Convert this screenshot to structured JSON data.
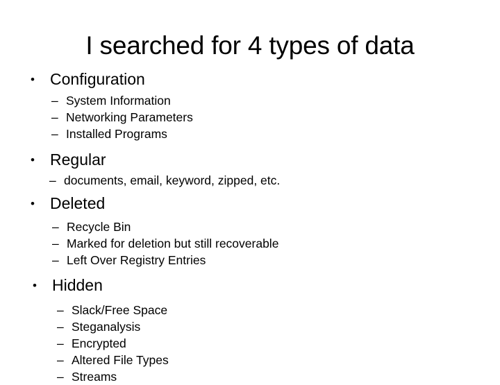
{
  "slide": {
    "title": "I searched for 4 types of data",
    "background_color": "#ffffff",
    "text_color": "#000000",
    "level1_bullet_glyph": "•",
    "level2_bullet_glyph": "–",
    "groups": [
      {
        "key": "configuration",
        "label": "Configuration",
        "items": [
          {
            "label": "System Information"
          },
          {
            "label": "Networking Parameters"
          },
          {
            "label": "Installed Programs"
          }
        ]
      },
      {
        "key": "regular",
        "label": "Regular",
        "items": [
          {
            "label": "documents, email, keyword, zipped, etc."
          }
        ]
      },
      {
        "key": "deleted",
        "label": "Deleted",
        "items": [
          {
            "label": "Recycle Bin"
          },
          {
            "label": "Marked for deletion but still recoverable"
          },
          {
            "label": "Left Over Registry Entries"
          }
        ]
      },
      {
        "key": "hidden",
        "label": "Hidden",
        "items": [
          {
            "label": "Slack/Free Space"
          },
          {
            "label": "Steganalysis"
          },
          {
            "label": "Encrypted"
          },
          {
            "label": "Altered File Types"
          },
          {
            "label": "Streams"
          }
        ]
      }
    ]
  }
}
